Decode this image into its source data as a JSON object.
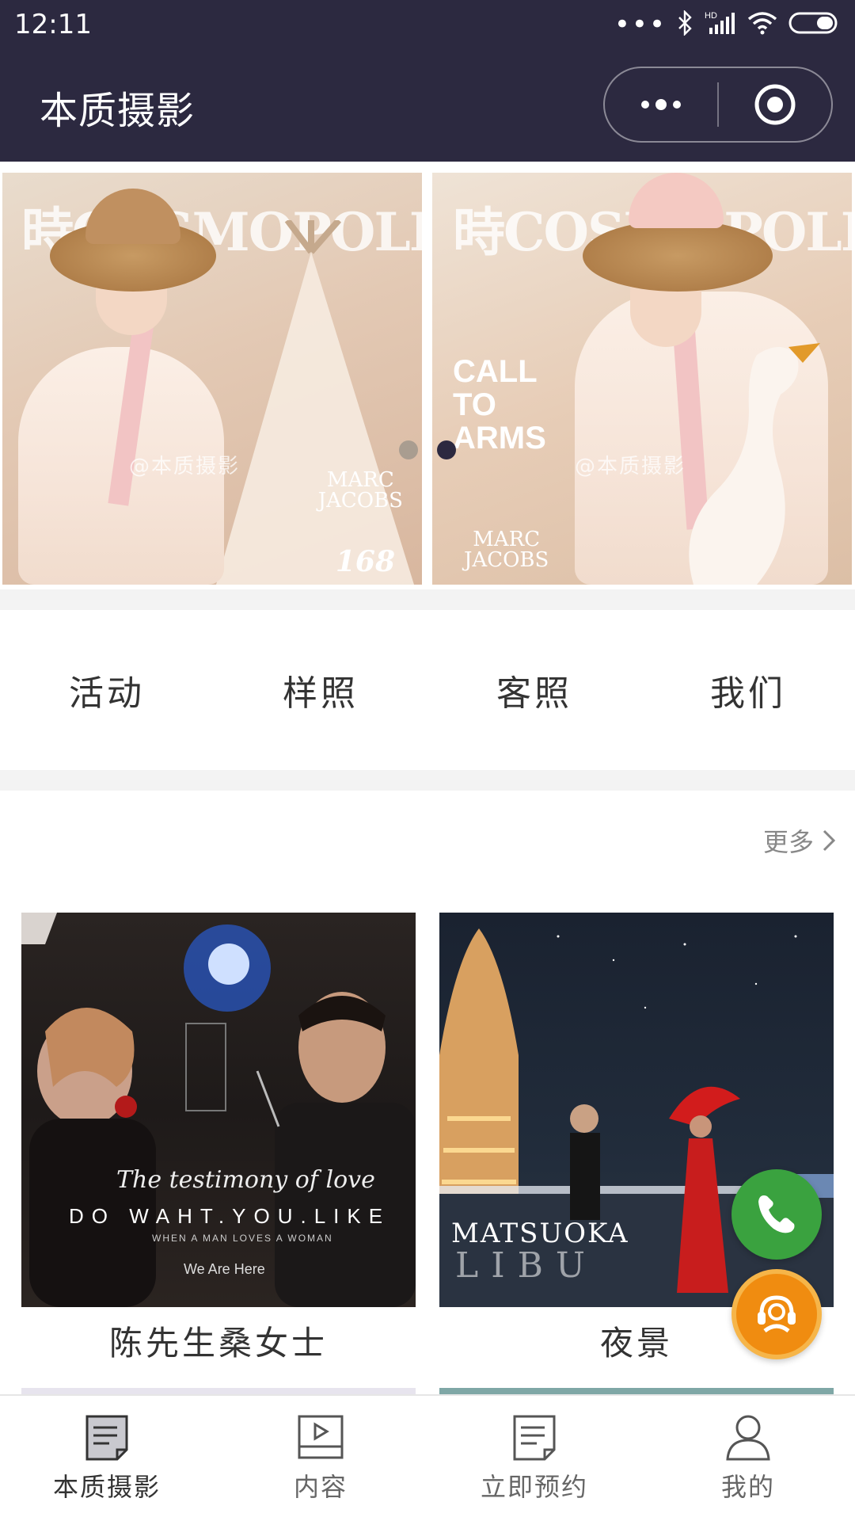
{
  "status_bar": {
    "time": "12:11",
    "dots": "•••",
    "hd_label": "HD"
  },
  "header": {
    "title": "本质摄影",
    "more_icon": "more-dots-icon",
    "close_icon": "target-icon",
    "background": "#2c2940"
  },
  "banner": {
    "slides": [
      {
        "brand": "時COSMOPOLITAN",
        "cover_name": "MARC\nJACOBS",
        "cover_number": "168",
        "watermark": "@本质摄影"
      },
      {
        "brand": "時COSMOPOLITAN",
        "callout": "CALL\nTO\nARMS",
        "cover_name": "MARC\nJACOBS",
        "watermark": "@本质摄影"
      }
    ],
    "active_index": 1
  },
  "nav": {
    "items": [
      {
        "label": "活动"
      },
      {
        "label": "样照"
      },
      {
        "label": "客照"
      },
      {
        "label": "我们"
      }
    ]
  },
  "gallery": {
    "more_label": "更多",
    "cards": [
      {
        "title": "陈先生桑女士",
        "overlay_main": "DO WAHT.YOU.LIKE",
        "overlay_sub": "WHEN A MAN LOVES A WOMAN",
        "overlay_script": "The testimony of love",
        "overlay_tag": "We Are Here"
      },
      {
        "title": "夜景",
        "overlay_main": "MATSUOKA",
        "overlay_sub": "LIBU"
      }
    ]
  },
  "floating": {
    "phone_color": "#3aa23f",
    "service_color": "#f08c10"
  },
  "tabbar": {
    "items": [
      {
        "label": "本质摄影",
        "icon": "article-icon",
        "active": true
      },
      {
        "label": "内容",
        "icon": "video-icon",
        "active": false
      },
      {
        "label": "立即预约",
        "icon": "booking-icon",
        "active": false
      },
      {
        "label": "我的",
        "icon": "user-icon",
        "active": false
      }
    ]
  }
}
